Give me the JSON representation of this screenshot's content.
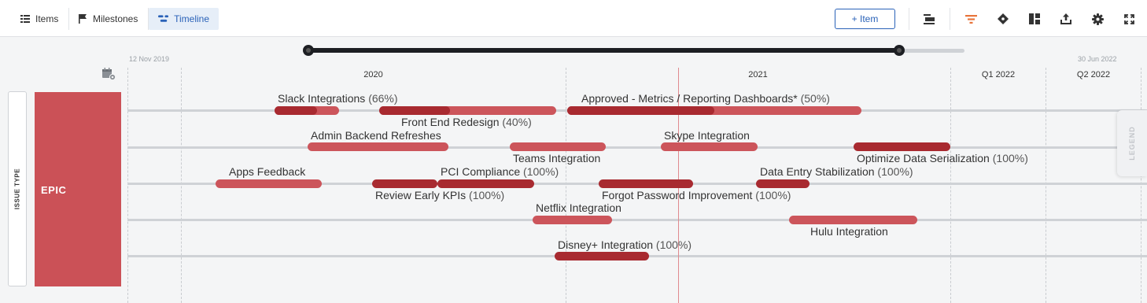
{
  "toolbar": {
    "views": [
      {
        "label": "Items",
        "icon": "list-icon"
      },
      {
        "label": "Milestones",
        "icon": "flag-icon"
      },
      {
        "label": "Timeline",
        "icon": "timeline-icon",
        "active": true
      }
    ],
    "add_item_label": "+ Item",
    "actions": [
      "collapse-rows-icon",
      "filter-icon",
      "milestone-diamond-icon",
      "layout-icon",
      "export-icon",
      "settings-gear-icon",
      "fullscreen-icon"
    ],
    "accent_color": "#e8743b"
  },
  "range": {
    "start_label": "12 Nov 2019",
    "end_label": "30 Jun 2022"
  },
  "periods": [
    "2020",
    "2021",
    "Q1 2022",
    "Q2 2022"
  ],
  "group_by_label": "ISSUE TYPE",
  "group_label": "EPIC",
  "legend_label": "LEGEND",
  "colors": {
    "bar": "#cc555b",
    "bar_done": "#a82a30",
    "group": "#cb5157",
    "today": "#e08a8e"
  },
  "items": [
    {
      "name": "Slack Integrations",
      "pct": "(66%)"
    },
    {
      "name": "Front End Redesign",
      "pct": "(40%)"
    },
    {
      "name": "Approved - Metrics / Reporting Dashboards*",
      "pct": "(50%)"
    },
    {
      "name": "Admin Backend Refreshes",
      "pct": ""
    },
    {
      "name": "Teams Integration",
      "pct": ""
    },
    {
      "name": "Skype Integration",
      "pct": ""
    },
    {
      "name": "Optimize Data Serialization",
      "pct": "(100%)"
    },
    {
      "name": "Apps Feedback",
      "pct": ""
    },
    {
      "name": "Review Early KPIs",
      "pct": "(100%)"
    },
    {
      "name": "PCI Compliance",
      "pct": "(100%)"
    },
    {
      "name": "Forgot Password Improvement",
      "pct": "(100%)"
    },
    {
      "name": "Data Entry Stabilization",
      "pct": "(100%)"
    },
    {
      "name": "Netflix Integration",
      "pct": ""
    },
    {
      "name": "Hulu Integration",
      "pct": ""
    },
    {
      "name": "Disney+ Integration",
      "pct": "(100%)"
    }
  ]
}
